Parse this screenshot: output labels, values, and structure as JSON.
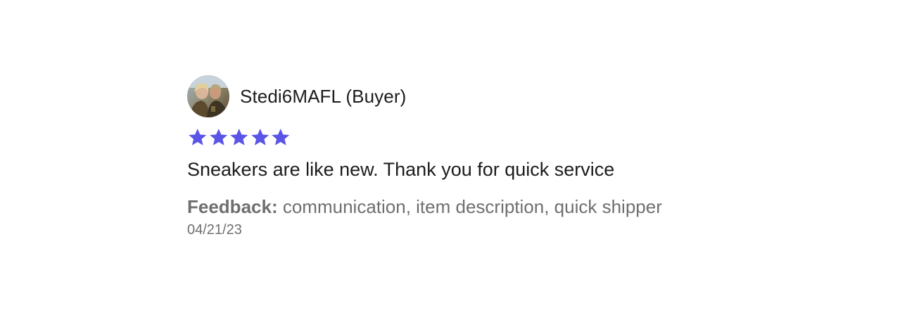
{
  "review": {
    "reviewer_name": "Stedi6MAFL (Buyer)",
    "avatar_icon": "user-photo-avatar",
    "rating": 5,
    "rating_max": 5,
    "star_color": "#5a55e6",
    "text": "Sneakers are like new. Thank you for quick service",
    "feedback_label": "Feedback:",
    "feedback_value": "communication, item description, quick shipper",
    "date": "04/21/23"
  }
}
